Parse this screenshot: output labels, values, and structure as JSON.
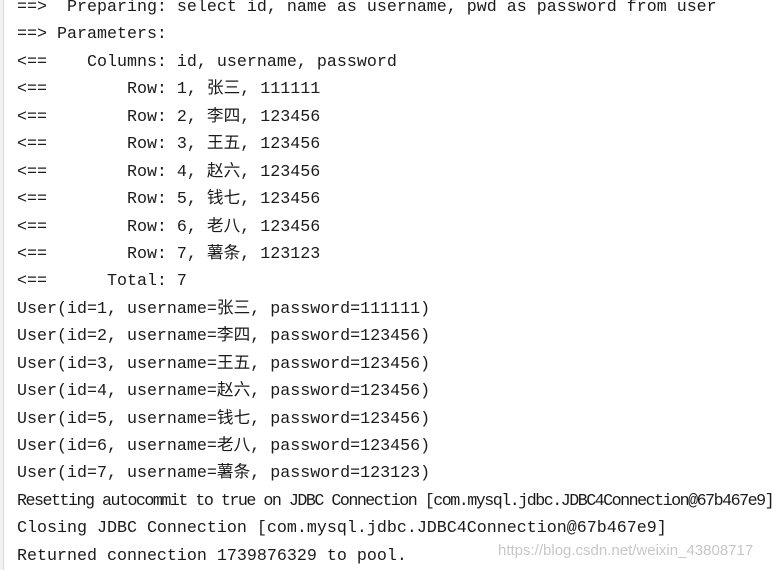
{
  "console": {
    "lines": [
      "==>  Preparing: select id, name as username, pwd as password from user",
      "==> Parameters: ",
      "<==    Columns: id, username, password",
      "<==        Row: 1, 张三, 111111",
      "<==        Row: 2, 李四, 123456",
      "<==        Row: 3, 王五, 123456",
      "<==        Row: 4, 赵六, 123456",
      "<==        Row: 5, 钱七, 123456",
      "<==        Row: 6, 老八, 123456",
      "<==        Row: 7, 薯条, 123123",
      "<==      Total: 7",
      "User(id=1, username=张三, password=111111)",
      "User(id=2, username=李四, password=123456)",
      "User(id=3, username=王五, password=123456)",
      "User(id=4, username=赵六, password=123456)",
      "User(id=5, username=钱七, password=123456)",
      "User(id=6, username=老八, password=123456)",
      "User(id=7, username=薯条, password=123123)",
      "Resetting autocommit to true on JDBC Connection [com.mysql.jdbc.JDBC4Connection@67b467e9]",
      "Closing JDBC Connection [com.mysql.jdbc.JDBC4Connection@67b467e9]",
      "Returned connection 1739876329 to pool."
    ]
  },
  "watermark": "https://blog.csdn.net/weixin_43808717"
}
